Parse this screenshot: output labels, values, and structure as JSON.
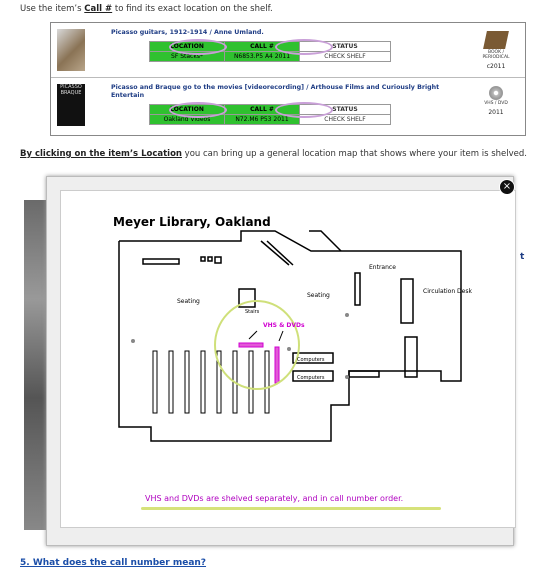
{
  "intro": {
    "prefix": "Use the item’s ",
    "bold": "Call #",
    "suffix": " to find its exact location on the shelf."
  },
  "records": [
    {
      "title": "Picasso guitars, 1912-1914 / Anne Umland.",
      "headers": [
        "LOCATION",
        "CALL #",
        "STATUS"
      ],
      "values": [
        "SF Stacks*",
        "N6853.P5 A4 2011",
        "CHECK SHELF"
      ],
      "media_label": "BOOK / PERIODICAL",
      "media_year": "c2011"
    },
    {
      "title": "Picasso and Braque go to the movies [videorecording] / Arthouse Films and Curiously Bright Entertain",
      "headers": [
        "LOCATION",
        "CALL #",
        "STATUS"
      ],
      "values": [
        "Oakland Videos",
        "N72.M6 P53 2011",
        "CHECK SHELF"
      ],
      "media_label": "VHS / DVD",
      "media_year": "2011",
      "thumb_text": "PICASSO BRAQUE"
    }
  ],
  "click_text": {
    "bold": "By clicking on the item’s Location",
    "rest": " you can bring up a general location map that shows where your item is shelved."
  },
  "map": {
    "title": "Meyer Library, Oakland",
    "labels": {
      "entrance": "Entrance",
      "circulation": "Circulation Desk",
      "seating_left": "Seating",
      "seating_right": "Seating",
      "stairs": "Stairs",
      "vhs": "VHS & DVDs",
      "computers1": "Computers",
      "computers2": "Computers"
    },
    "caption": "VHS and DVDs are shelved separately, and in call number order."
  },
  "close_glyph": "×",
  "right_edge": "t",
  "question": "5. What does the call number mean?",
  "colors": {
    "green": "#2fc12f",
    "oval": "#c9a0d8",
    "vhs": "#d000d0",
    "circle": "#cfe07a",
    "link": "#1b4ea8"
  }
}
